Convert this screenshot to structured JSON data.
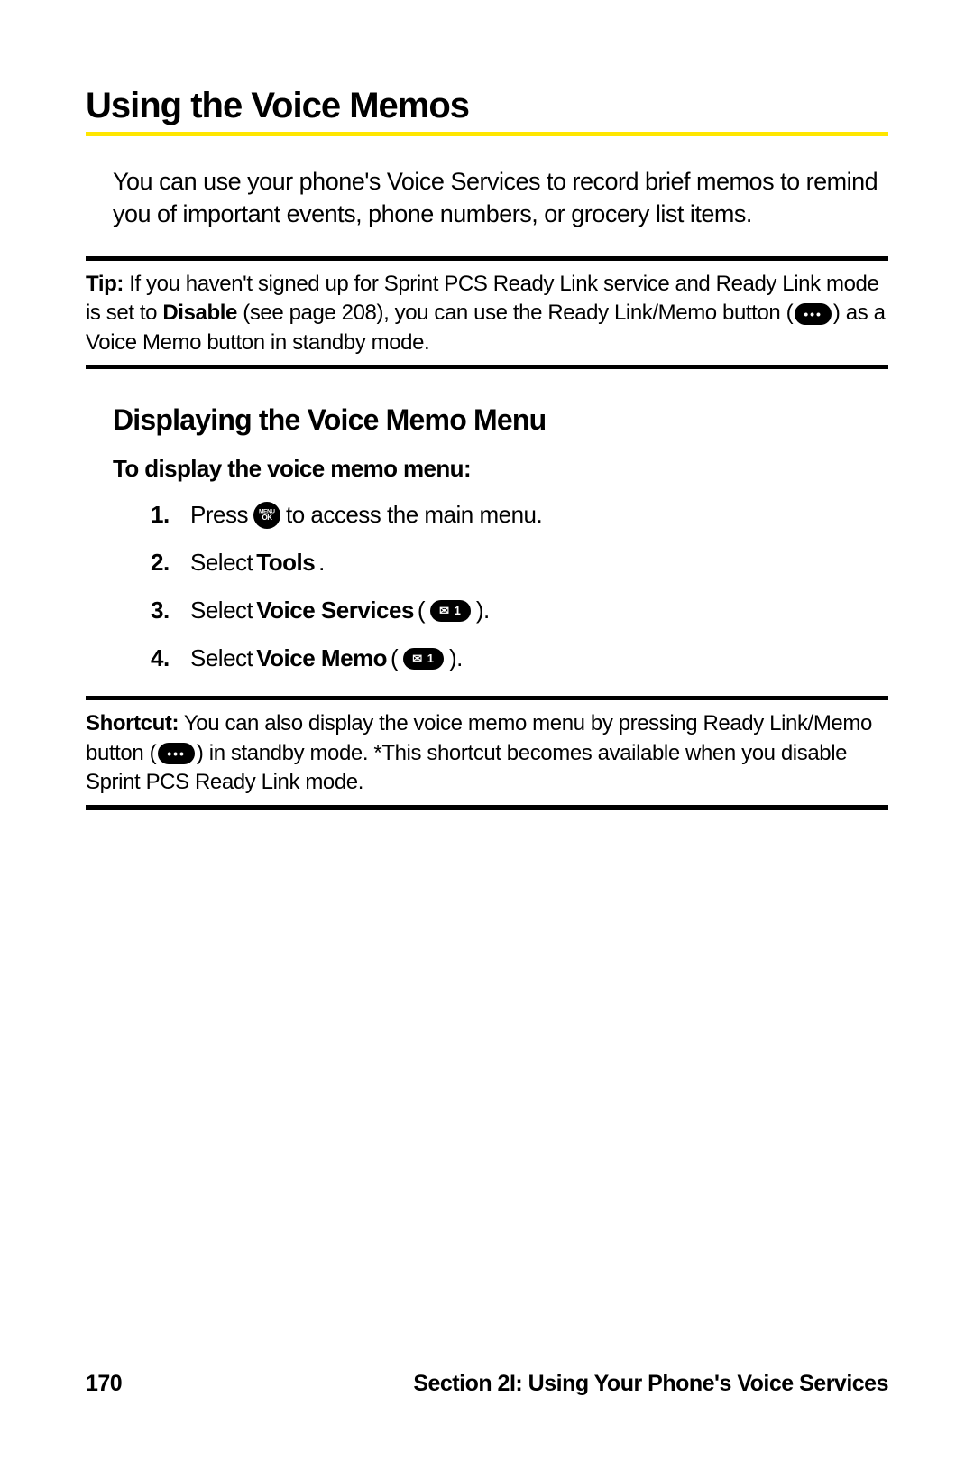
{
  "heading": "Using the Voice Memos",
  "intro": "You can use your phone's Voice Services to record brief memos to remind you of important events, phone numbers, or grocery list items.",
  "tip": {
    "label": "Tip:",
    "part1": " If you haven't signed up for Sprint PCS Ready Link service and Ready Link mode is set to ",
    "bold1": "Disable",
    "part2": " (see page 208), you can use the Ready Link/Memo button (",
    "part3": ") as a Voice Memo button in standby mode."
  },
  "subheading": "Displaying the Voice Memo Menu",
  "instruction": "To display the voice memo menu:",
  "steps": [
    {
      "num": "1.",
      "pre": "Press ",
      "icon": "menuok",
      "post": " to access the main menu."
    },
    {
      "num": "2.",
      "pre": "Select ",
      "bold": "Tools",
      "post": "."
    },
    {
      "num": "3.",
      "pre": "Select ",
      "bold": "Voice Services",
      "post1": " (",
      "icon": "mail1",
      "post2": ")."
    },
    {
      "num": "4.",
      "pre": "Select ",
      "bold": "Voice Memo",
      "post1": " (",
      "icon": "mail1",
      "post2": ")."
    }
  ],
  "shortcut": {
    "label": "Shortcut:",
    "part1": " You can also display the voice memo menu by pressing Ready Link/Memo button (",
    "part2": ") in standby mode. *This shortcut becomes available when you disable Sprint PCS Ready Link mode."
  },
  "footer": {
    "page": "170",
    "section": "Section 2I: Using Your Phone's Voice Services"
  }
}
